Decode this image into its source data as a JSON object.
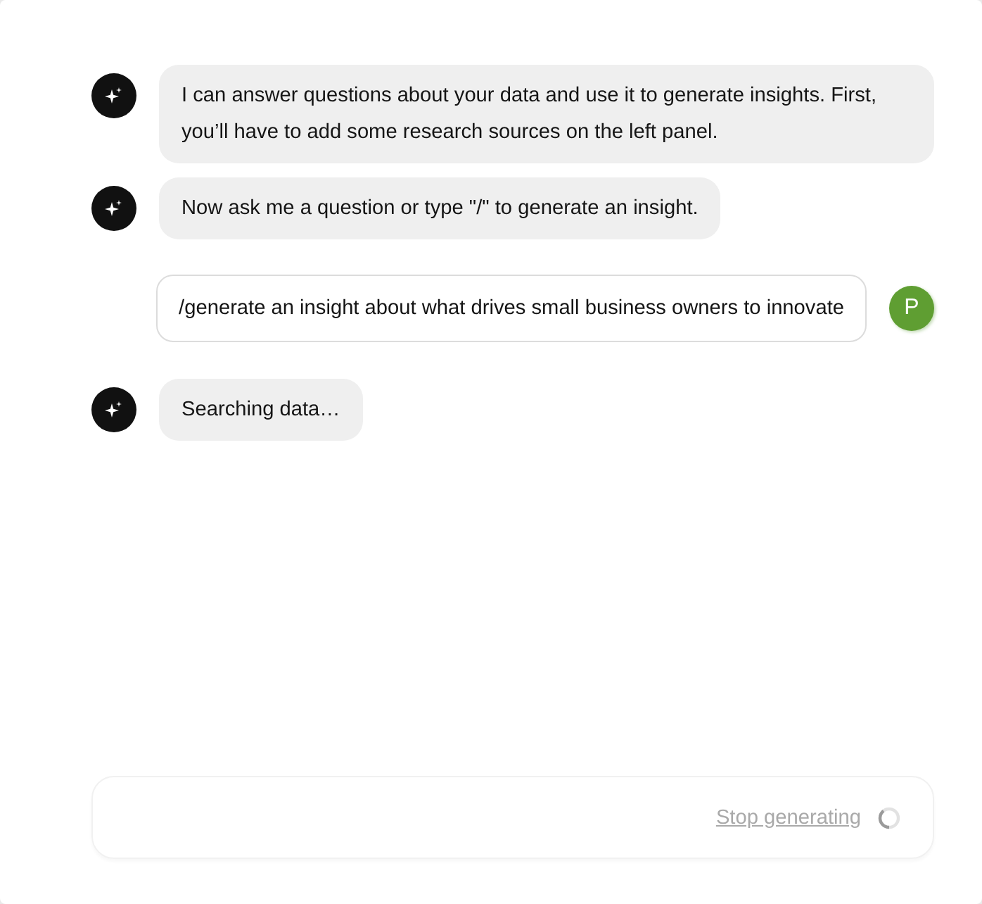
{
  "messages": [
    {
      "kind": "bot",
      "text": "I can answer questions about your data and use it to generate insights. First, you’ll have to add some research sources on the left panel."
    },
    {
      "kind": "bot",
      "text": "Now ask me a question or type \"/\" to generate an insight."
    },
    {
      "kind": "user",
      "text": "/generate an insight about what drives small business owners to innovate",
      "avatar": "P"
    },
    {
      "kind": "bot",
      "text": "Searching data…"
    }
  ],
  "composer": {
    "stop_label": "Stop generating",
    "generating": true
  }
}
